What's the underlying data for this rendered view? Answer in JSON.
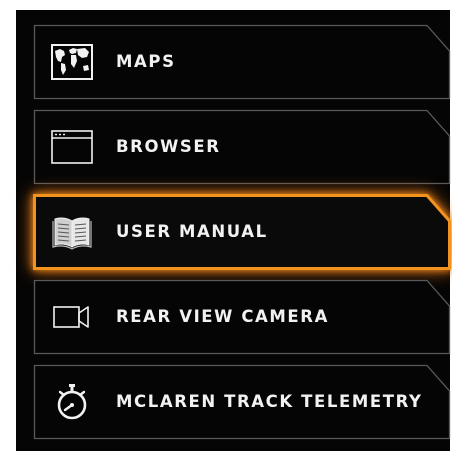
{
  "menu": {
    "items": [
      {
        "label": "MAPS",
        "icon": "world-map-icon",
        "selected": false
      },
      {
        "label": "BROWSER",
        "icon": "browser-window-icon",
        "selected": false
      },
      {
        "label": "USER MANUAL",
        "icon": "book-icon",
        "selected": true
      },
      {
        "label": "REAR VIEW CAMERA",
        "icon": "video-camera-icon",
        "selected": false
      },
      {
        "label": "MCLAREN TRACK TELEMETRY",
        "icon": "stopwatch-icon",
        "selected": false
      }
    ]
  },
  "colors": {
    "background": "#050505",
    "outline": "#5a5a5a",
    "accent": "#f2921f",
    "text": "#f2f2f2"
  }
}
